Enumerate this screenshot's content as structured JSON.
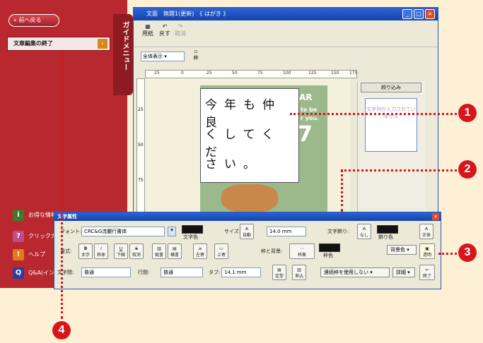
{
  "guide": {
    "tab_label": "ガイドメニュー",
    "back_label": "前へ戻る",
    "finish_label": "文章編集の終了",
    "bottom_items": [
      {
        "icon": "info-icon",
        "label": "お得な情報(インターネット接続)"
      },
      {
        "icon": "question-icon",
        "label": "クリックガイド"
      },
      {
        "icon": "help-icon",
        "label": "ヘルプ"
      },
      {
        "icon": "qa-icon",
        "label": "Q&A(インター"
      }
    ]
  },
  "window": {
    "title": "文面　無題1(更新)　《 はがき 》",
    "toolbar": {
      "paper": "用紙",
      "undo": "戻す",
      "cancel": "取消"
    },
    "zoom": "全体表示",
    "frame": "枠",
    "ruler_marks": [
      "25",
      "0",
      "25",
      "50",
      "75",
      "100",
      "125",
      "150",
      "175"
    ],
    "vruler_marks": [
      "25",
      "50",
      "75"
    ],
    "card_text": [
      "今年も仲良",
      "くしてくだ",
      "さい。"
    ],
    "card_bg_text": [
      "to be",
      "r you.",
      "7",
      "AR"
    ],
    "filter_label": "絞り込み",
    "preview_text": "文字列が入力されていません"
  },
  "dialog": {
    "title": "文字属性",
    "font_label": "フォント:",
    "font_value": "CRC&G流麗行書体",
    "text_color_label": "文字色",
    "size_label": "サイズ:",
    "auto_label": "自動",
    "size_value": "14.0 mm",
    "decoration_label": "文字飾り:",
    "decoration_none": "なし",
    "decoration_color": "飾り色",
    "upright_label": "正体",
    "style_label": "書式:",
    "style_buttons": [
      "太字",
      "斜体",
      "下線",
      "取消",
      "縦書",
      "横書",
      "左寄",
      "上寄"
    ],
    "frame_bg_label": "枠と背景:",
    "no_frame": "枠無",
    "frame_color": "枠色",
    "bg_color": "背景色",
    "transparent": "透明",
    "char_spacing_label": "文字間:",
    "char_spacing_value": "普通",
    "line_spacing_label": "行間:",
    "line_spacing_value": "普通",
    "tab_label": "タブ:",
    "tab_value": "14.1 mm",
    "fixed_label": "定型",
    "insert_label": "差込",
    "continuous_label": "連続枠を使用しない",
    "details_label": "詳細",
    "end_label": "終了"
  },
  "callouts": [
    "1",
    "2",
    "3",
    "4"
  ],
  "colors": {
    "guide": "#b8282e",
    "titlebar": "#1544a8",
    "callout": "#d5161d",
    "background": "#fdf0d5"
  }
}
